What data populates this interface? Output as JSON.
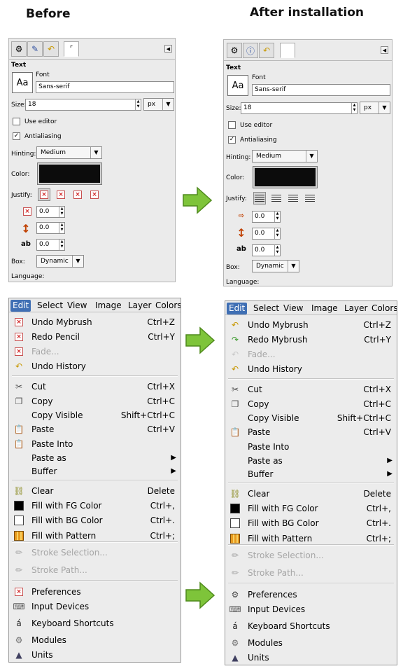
{
  "headings": {
    "before": "Before",
    "after": "After installation"
  },
  "text_tool": {
    "section_title": "Text",
    "font_label": "Font",
    "font_preview": "Aa",
    "font_value": "Sans-serif",
    "size_label": "Size:",
    "size_value": "18",
    "size_unit": "px",
    "use_editor_label": "Use editor",
    "antialiasing_label": "Antialiasing",
    "antialiasing_checked": true,
    "hinting_label": "Hinting:",
    "hinting_value": "Medium",
    "color_label": "Color:",
    "color_value": "#0c0c0c",
    "justify_label": "Justify:",
    "indent_value": "0.0",
    "line_spacing_value": "0.0",
    "letter_spacing_value": "0.0",
    "letter_spacing_glyph": "ab",
    "box_label": "Box:",
    "box_value": "Dynamic",
    "language_label": "Language:"
  },
  "menu": {
    "bar": [
      "Edit",
      "Select",
      "View",
      "Image",
      "Layer",
      "Colors"
    ],
    "active_index": 0,
    "before": [
      {
        "label": "Undo Mybrush",
        "accel": "Ctrl+Z",
        "icon": "undo-broken-icon"
      },
      {
        "label": "Redo Pencil",
        "accel": "Ctrl+Y",
        "icon": "redo-broken-icon"
      },
      {
        "label": "Fade...",
        "accel": "",
        "icon": "fade-broken-icon",
        "disabled": true
      },
      {
        "label": "Undo History",
        "accel": "",
        "icon": "undo-history-icon"
      },
      {
        "label": "Cut",
        "accel": "Ctrl+X",
        "icon": "scissors-icon"
      },
      {
        "label": "Copy",
        "accel": "Ctrl+C",
        "icon": "copy-icon"
      },
      {
        "label": "Copy Visible",
        "accel": "Shift+Ctrl+C",
        "icon": ""
      },
      {
        "label": "Paste",
        "accel": "Ctrl+V",
        "icon": "paste-icon"
      },
      {
        "label": "Paste Into",
        "accel": "",
        "icon": "paste-into-icon"
      },
      {
        "label": "Paste as",
        "accel": "",
        "icon": "",
        "submenu": true
      },
      {
        "label": "Buffer",
        "accel": "",
        "icon": "",
        "submenu": true
      },
      {
        "label": "Clear",
        "accel": "Delete",
        "icon": "clear-icon"
      },
      {
        "label": "Fill with FG Color",
        "accel": "Ctrl+,",
        "icon": "fill-fg-icon"
      },
      {
        "label": "Fill with BG Color",
        "accel": "Ctrl+.",
        "icon": "fill-bg-icon"
      },
      {
        "label": "Fill with Pattern",
        "accel": "Ctrl+;",
        "icon": "fill-pattern-icon"
      },
      {
        "label": "Stroke Selection...",
        "accel": "",
        "icon": "stroke-selection-icon",
        "disabled": true
      },
      {
        "label": "Stroke Path...",
        "accel": "",
        "icon": "stroke-path-icon",
        "disabled": true
      },
      {
        "label": "Preferences",
        "accel": "",
        "icon": "preferences-broken-icon"
      },
      {
        "label": "Input Devices",
        "accel": "",
        "icon": "input-devices-icon"
      },
      {
        "label": "Keyboard Shortcuts",
        "accel": "",
        "icon": "keyboard-shortcuts-icon"
      },
      {
        "label": "Modules",
        "accel": "",
        "icon": "modules-icon"
      },
      {
        "label": "Units",
        "accel": "",
        "icon": "units-icon"
      }
    ],
    "after": [
      {
        "label": "Undo Mybrush",
        "accel": "Ctrl+Z",
        "icon": "undo-icon"
      },
      {
        "label": "Redo Mybrush",
        "accel": "Ctrl+Y",
        "icon": "redo-icon"
      },
      {
        "label": "Fade...",
        "accel": "",
        "icon": "fade-icon",
        "disabled": true
      },
      {
        "label": "Undo History",
        "accel": "",
        "icon": "undo-history-icon"
      },
      {
        "label": "Cut",
        "accel": "Ctrl+X",
        "icon": "scissors-icon"
      },
      {
        "label": "Copy",
        "accel": "Ctrl+C",
        "icon": "copy-icon"
      },
      {
        "label": "Copy Visible",
        "accel": "Shift+Ctrl+C",
        "icon": ""
      },
      {
        "label": "Paste",
        "accel": "Ctrl+V",
        "icon": "paste-icon"
      },
      {
        "label": "Paste Into",
        "accel": "",
        "icon": ""
      },
      {
        "label": "Paste as",
        "accel": "",
        "icon": "",
        "submenu": true
      },
      {
        "label": "Buffer",
        "accel": "",
        "icon": "",
        "submenu": true
      },
      {
        "label": "Clear",
        "accel": "Delete",
        "icon": "clear-icon"
      },
      {
        "label": "Fill with FG Color",
        "accel": "Ctrl+,",
        "icon": "fill-fg-icon"
      },
      {
        "label": "Fill with BG Color",
        "accel": "Ctrl+.",
        "icon": "fill-bg-icon"
      },
      {
        "label": "Fill with Pattern",
        "accel": "Ctrl+;",
        "icon": "fill-pattern-icon"
      },
      {
        "label": "Stroke Selection...",
        "accel": "",
        "icon": "stroke-selection-icon",
        "disabled": true
      },
      {
        "label": "Stroke Path...",
        "accel": "",
        "icon": "stroke-path-icon",
        "disabled": true
      },
      {
        "label": "Preferences",
        "accel": "",
        "icon": "preferences-icon"
      },
      {
        "label": "Input Devices",
        "accel": "",
        "icon": "input-devices-icon"
      },
      {
        "label": "Keyboard Shortcuts",
        "accel": "",
        "icon": "keyboard-shortcuts-icon"
      },
      {
        "label": "Modules",
        "accel": "",
        "icon": "modules-icon"
      },
      {
        "label": "Units",
        "accel": "",
        "icon": "units-icon"
      }
    ]
  },
  "colors": {
    "arrow": "#7ec43a",
    "menu_highlight": "#3f6fb4"
  }
}
